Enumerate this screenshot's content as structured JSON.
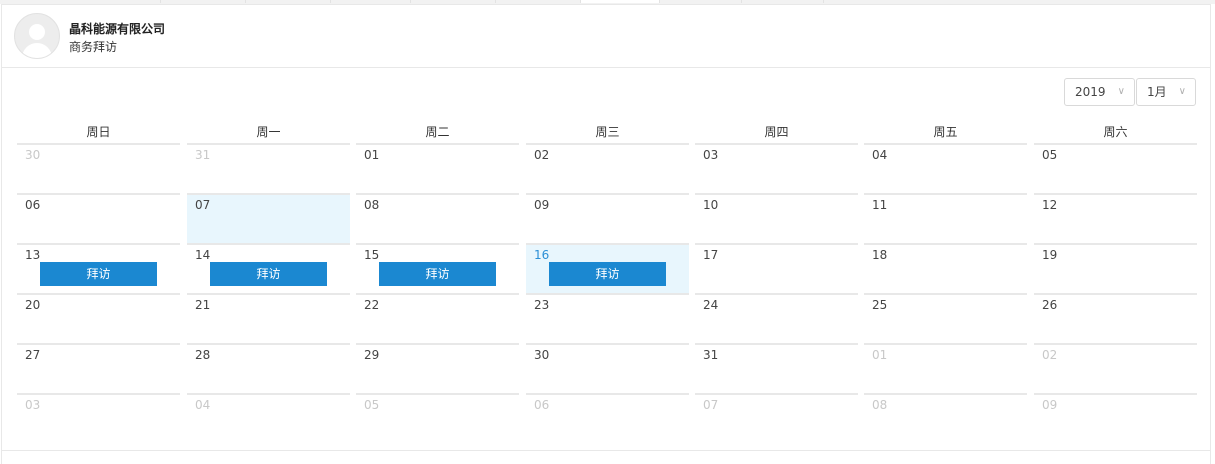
{
  "header": {
    "company": "晶科能源有限公司",
    "subtitle": "商务拜访"
  },
  "controls": {
    "year": "2019",
    "month": "1月",
    "chevron_icon": "chevron-down-icon"
  },
  "calendar": {
    "weekdays": [
      "周日",
      "周一",
      "周二",
      "周三",
      "周四",
      "周五",
      "周六"
    ],
    "event_label": "拜访",
    "weeks": [
      [
        "30",
        "31",
        "01",
        "02",
        "03",
        "04",
        "05"
      ],
      [
        "06",
        "07",
        "08",
        "09",
        "10",
        "11",
        "12"
      ],
      [
        "13",
        "14",
        "15",
        "16",
        "17",
        "18",
        "19"
      ],
      [
        "20",
        "21",
        "22",
        "23",
        "24",
        "25",
        "26"
      ],
      [
        "27",
        "28",
        "29",
        "30",
        "31",
        "01",
        "02"
      ],
      [
        "03",
        "04",
        "05",
        "06",
        "07",
        "08",
        "09"
      ]
    ],
    "other_month": [
      [
        0,
        0
      ],
      [
        0,
        1
      ],
      [
        4,
        5
      ],
      [
        4,
        6
      ],
      [
        5,
        0
      ],
      [
        5,
        1
      ],
      [
        5,
        2
      ],
      [
        5,
        3
      ],
      [
        5,
        4
      ],
      [
        5,
        5
      ],
      [
        5,
        6
      ]
    ],
    "selected_days": [
      [
        1,
        1
      ],
      [
        2,
        3
      ]
    ],
    "today": [
      2,
      3
    ],
    "events": [
      [
        2,
        0
      ],
      [
        2,
        1
      ],
      [
        2,
        2
      ],
      [
        2,
        3
      ]
    ],
    "underline_cell": [
      2,
      0
    ],
    "colors": {
      "accent": "#1b88d1",
      "today_text": "#2b8fd6",
      "selected_bg": "#e8f6fd",
      "muted": "#c8c8c8"
    }
  }
}
